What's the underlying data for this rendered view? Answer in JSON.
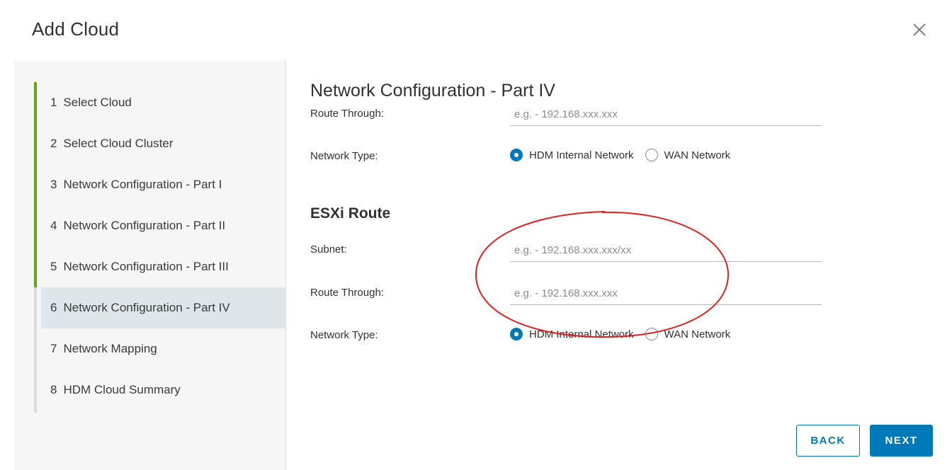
{
  "dialog": {
    "title": "Add Cloud"
  },
  "steps": [
    {
      "num": "1",
      "label": "Select Cloud"
    },
    {
      "num": "2",
      "label": "Select Cloud Cluster"
    },
    {
      "num": "3",
      "label": "Network Configuration - Part I"
    },
    {
      "num": "4",
      "label": "Network Configuration - Part II"
    },
    {
      "num": "5",
      "label": "Network Configuration - Part III"
    },
    {
      "num": "6",
      "label": "Network Configuration - Part IV"
    },
    {
      "num": "7",
      "label": "Network Mapping"
    },
    {
      "num": "8",
      "label": "HDM Cloud Summary"
    }
  ],
  "active_step": 6,
  "content": {
    "title": "Network Configuration - Part IV",
    "route1": {
      "label": "Route Through:",
      "value": "",
      "placeholder": "e.g. - 192.168.xxx.xxx"
    },
    "type1": {
      "label": "Network Type:",
      "option1": "HDM Internal Network",
      "option2": "WAN Network",
      "selected": "HDM Internal Network"
    },
    "esxi": {
      "title": "ESXi Route",
      "subnet": {
        "label": "Subnet:",
        "value": "",
        "placeholder": "e.g. - 192.168.xxx.xxx/xx"
      },
      "route": {
        "label": "Route Through:",
        "value": "",
        "placeholder": "e.g. - 192.168.xxx.xxx"
      },
      "type": {
        "label": "Network Type:",
        "option1": "HDM Internal Network",
        "option2": "WAN Network",
        "selected": "HDM Internal Network"
      }
    }
  },
  "buttons": {
    "back": "BACK",
    "next": "NEXT"
  },
  "colors": {
    "accent": "#0079b8",
    "progress": "#62a420",
    "annotation": "#e0201c"
  },
  "icons": {
    "close": "close-icon"
  }
}
